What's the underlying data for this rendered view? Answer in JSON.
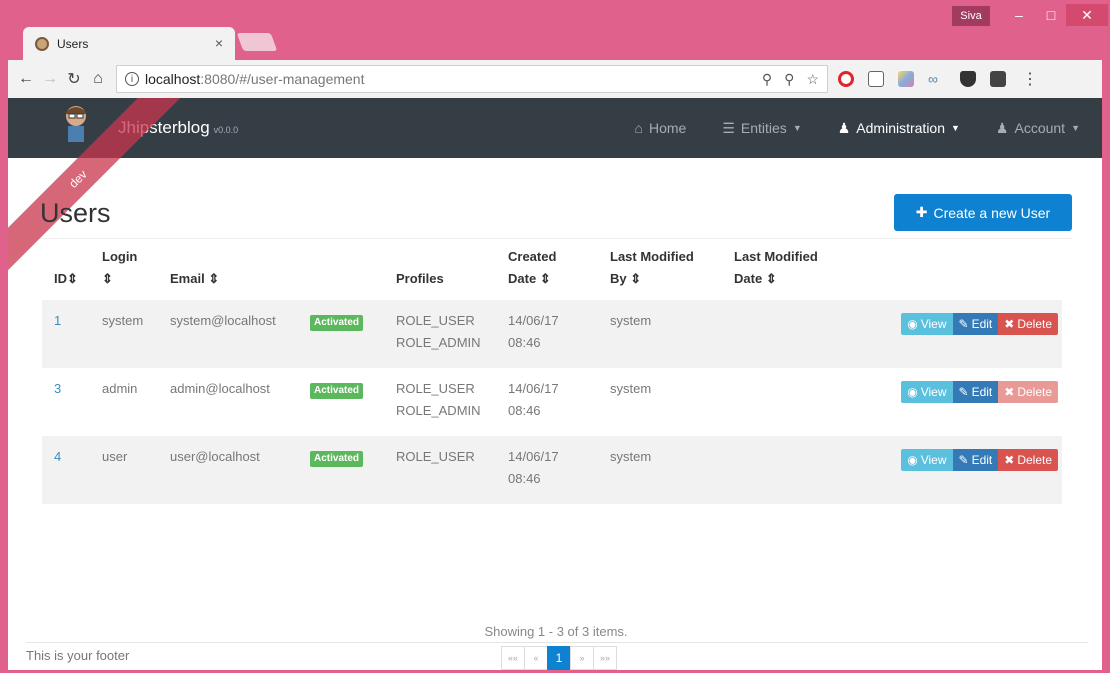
{
  "browser": {
    "tab_title": "Users",
    "tab_close": "×",
    "profile_name": "Siva",
    "url_host": "localhost",
    "url_path": ":8080/#/user-management"
  },
  "app": {
    "brand": "Jhipsterblog",
    "version": "v0.0.0",
    "ribbon": "dev",
    "nav": {
      "home": "Home",
      "entities": "Entities",
      "administration": "Administration",
      "account": "Account"
    }
  },
  "users_page": {
    "title": "Users",
    "create_button": "Create a new User",
    "columns": {
      "id": "ID",
      "login": "Login",
      "email": "Email",
      "profiles": "Profiles",
      "created_date_1": "Created",
      "created_date_2": "Date",
      "modified_by_1": "Last Modified",
      "modified_by_2": "By",
      "modified_date_1": "Last Modified",
      "modified_date_2": "Date"
    },
    "rows": [
      {
        "id": "1",
        "login": "system",
        "email": "system@localhost",
        "status": "Activated",
        "profile_1": "ROLE_USER",
        "profile_2": "ROLE_ADMIN",
        "created_1": "14/06/17",
        "created_2": "08:46",
        "modified_by": "system",
        "modified_date": ""
      },
      {
        "id": "3",
        "login": "admin",
        "email": "admin@localhost",
        "status": "Activated",
        "profile_1": "ROLE_USER",
        "profile_2": "ROLE_ADMIN",
        "created_1": "14/06/17",
        "created_2": "08:46",
        "modified_by": "system",
        "modified_date": ""
      },
      {
        "id": "4",
        "login": "user",
        "email": "user@localhost",
        "status": "Activated",
        "profile_1": "ROLE_USER",
        "profile_2": "",
        "created_1": "14/06/17",
        "created_2": "08:46",
        "modified_by": "system",
        "modified_date": ""
      }
    ],
    "actions": {
      "view": "View",
      "edit": "Edit",
      "delete": "Delete"
    },
    "showing": "Showing 1 - 3 of 3 items.",
    "pagination": {
      "first": "««",
      "prev": "«",
      "current": "1",
      "next": "»",
      "last": "»»"
    }
  },
  "footer": "This is your footer"
}
